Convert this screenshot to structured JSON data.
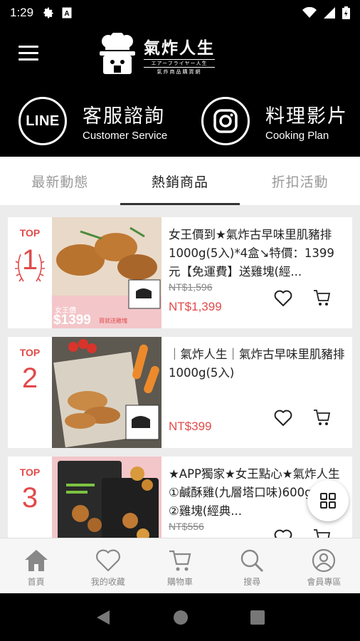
{
  "status_bar": {
    "time": "1:29",
    "left_icons": [
      "gear-icon",
      "a-box-icon"
    ],
    "right_icons": [
      "wifi-icon",
      "signal-icon",
      "battery-icon"
    ]
  },
  "header": {
    "logo": {
      "title": "氣炸人生",
      "sub1": "エアーフライヤー人生",
      "sub2": "氣炸商品購買網"
    },
    "social": [
      {
        "icon": "line-icon",
        "icon_text": "LINE",
        "label": "客服諮詢",
        "sublabel": "Customer Service"
      },
      {
        "icon": "instagram-icon",
        "label": "料理影片",
        "sublabel": "Cooking Plan"
      }
    ]
  },
  "tabs": [
    {
      "label": "最新動態",
      "active": false
    },
    {
      "label": "熱銷商品",
      "active": true
    },
    {
      "label": "折扣活動",
      "active": false
    }
  ],
  "products": [
    {
      "rank_label": "TOP",
      "rank": "1",
      "title": "女王價到★氣炸古早味里肌豬排1000g(5入)*4盒↘特價：1399元【免運費】送雞塊(經...",
      "old_price": "NT$1,596",
      "price": "NT$1,399",
      "image_badge_label": "女王價",
      "image_badge_price": "$1399",
      "image_badge_extra": "買就送雞塊"
    },
    {
      "rank_label": "TOP",
      "rank": "2",
      "title": "｜氣炸人生｜氣炸古早味里肌豬排1000g(5入)",
      "old_price": "",
      "price": "NT$399"
    },
    {
      "rank_label": "TOP",
      "rank": "3",
      "title": "★APP獨家★女王點心★氣炸人生①鹹酥雞(九層塔口味)600g*2包②雞塊(經典...",
      "old_price": "NT$556",
      "price": ""
    }
  ],
  "bottom_nav": [
    {
      "icon": "home-icon",
      "label": "首頁",
      "active": true
    },
    {
      "icon": "heart-icon",
      "label": "我的收藏",
      "active": false
    },
    {
      "icon": "cart-icon",
      "label": "購物車",
      "active": false
    },
    {
      "icon": "search-icon",
      "label": "搜尋",
      "active": false
    },
    {
      "icon": "user-icon",
      "label": "會員專區",
      "active": false
    }
  ],
  "colors": {
    "accent_red": "#e14a4a",
    "header_bg": "#000000",
    "page_bg": "#ececec"
  }
}
